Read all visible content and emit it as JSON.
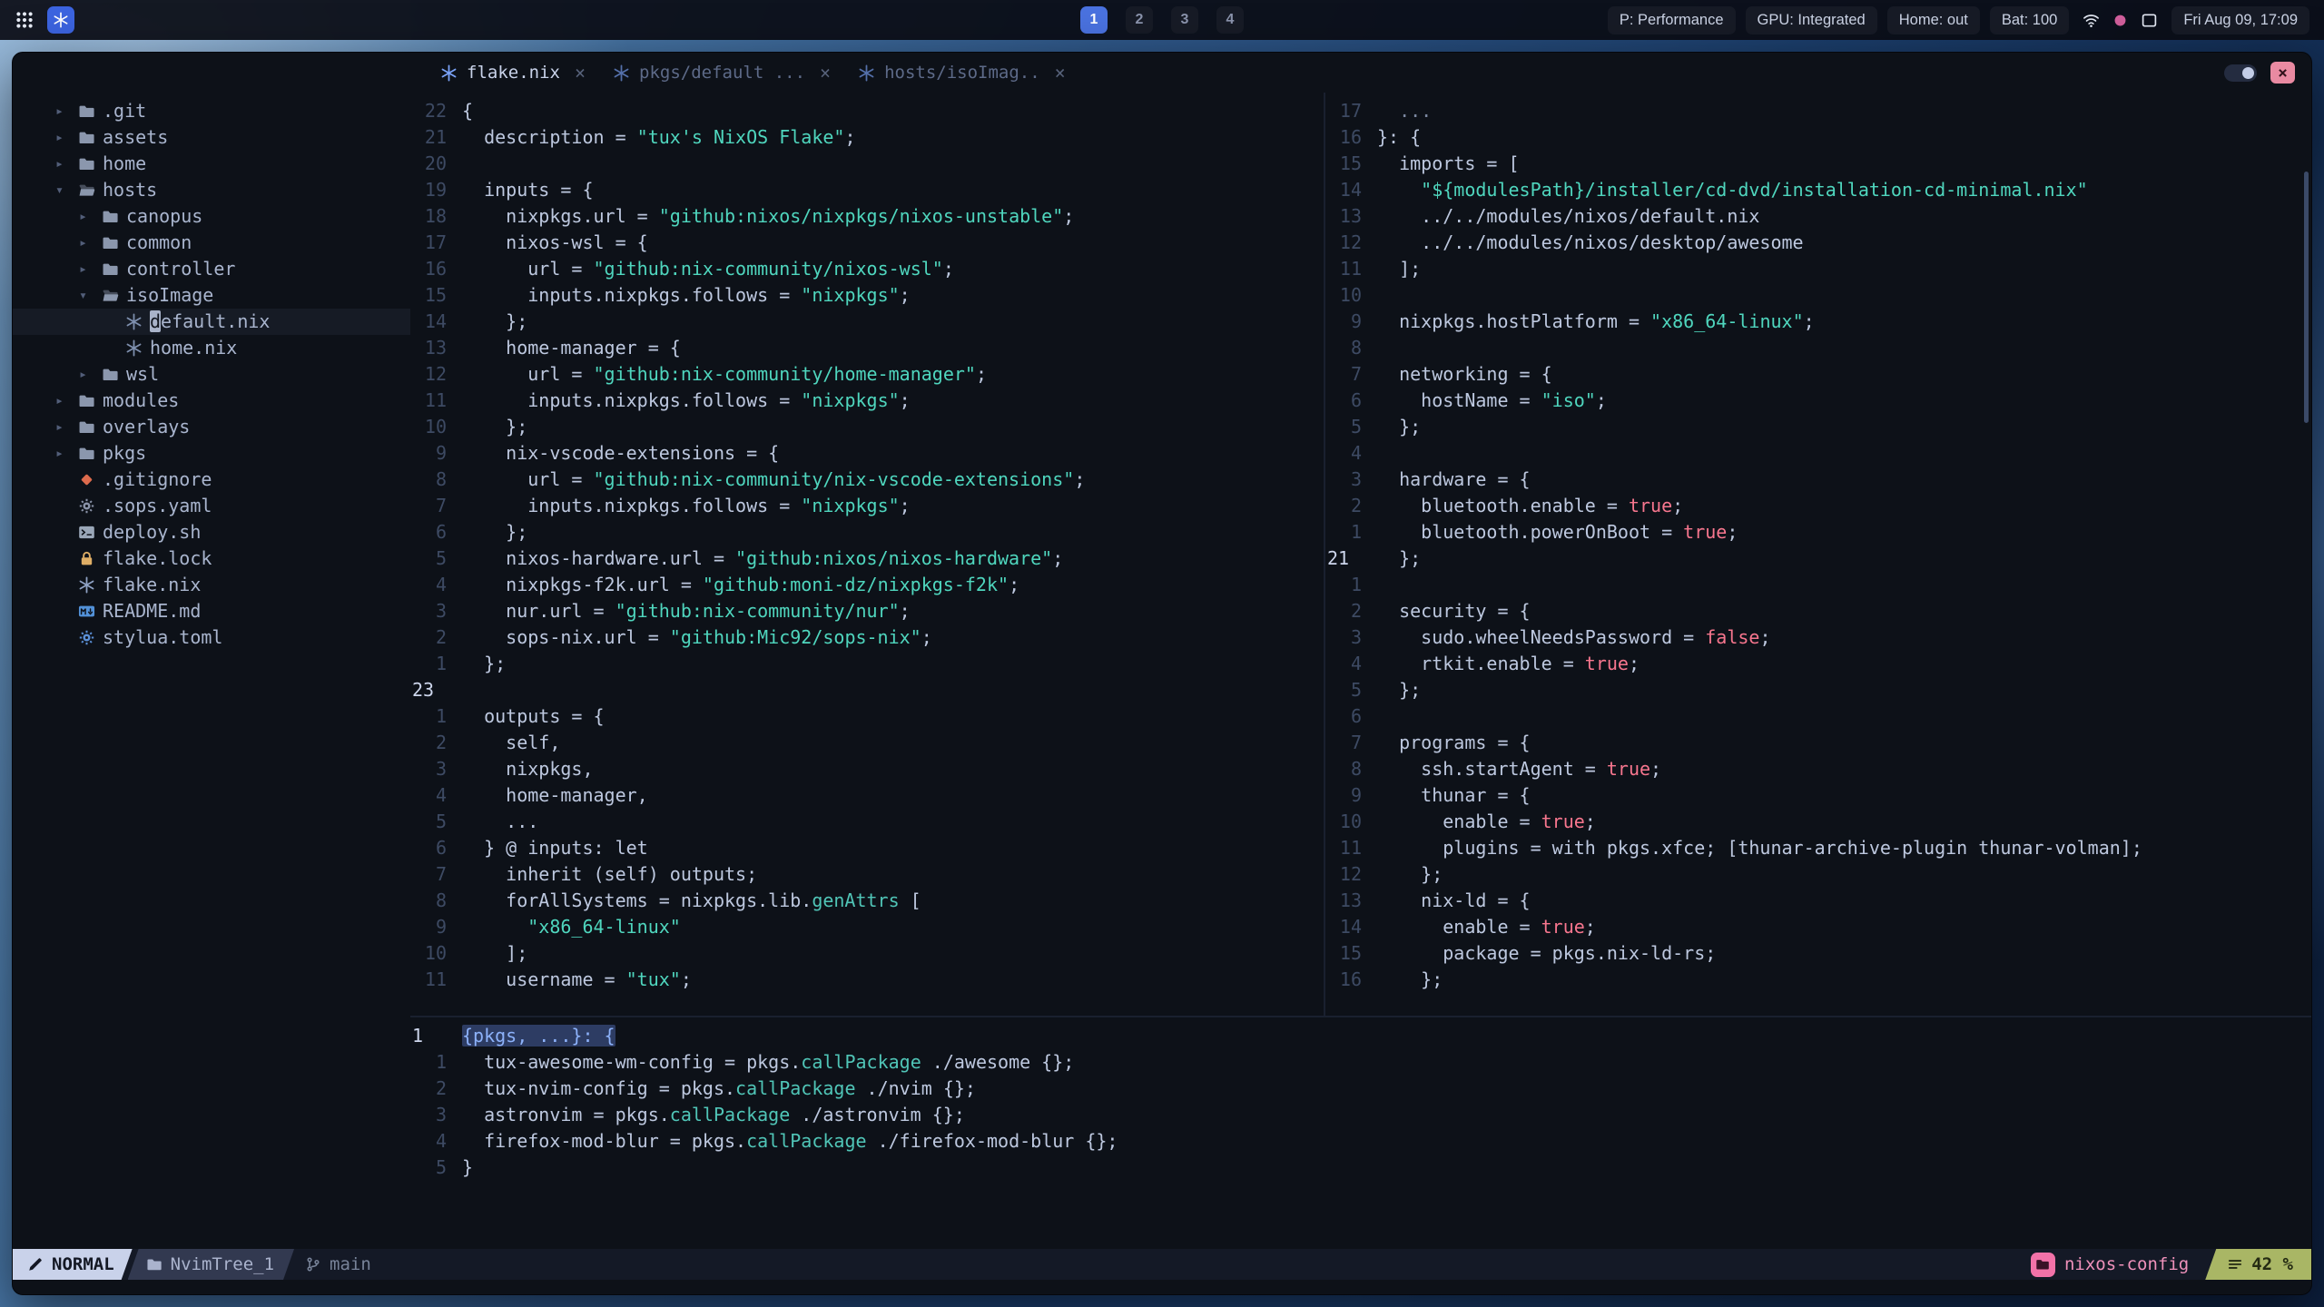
{
  "theme": {
    "editor_bg": "#0d1118",
    "string_teal": "#4fd6be",
    "boolean_pink": "#f7768e",
    "accent_blue": "#7aa2f7",
    "workspace_active_blue": "#4a72e0",
    "mode_segment_bg": "#c9d2ea",
    "percent_green": "#a9b665",
    "project_pink": "#f272a8",
    "close_button_red": "#e98aa2"
  },
  "topbar": {
    "workspaces": [
      {
        "label": "1",
        "active": true
      },
      {
        "label": "2",
        "active": false
      },
      {
        "label": "3",
        "active": false
      },
      {
        "label": "4",
        "active": false
      }
    ],
    "status": [
      {
        "label": "P: Performance"
      },
      {
        "label": "GPU: Integrated"
      },
      {
        "label": "Home: out"
      },
      {
        "label": "Bat: 100"
      }
    ],
    "tray_icons": [
      {
        "name": "wifi-icon",
        "icon": "wifi-icon"
      },
      {
        "name": "indicator-dot-icon",
        "icon": "dot-icon",
        "color": "#d15f9c"
      },
      {
        "name": "screen-icon",
        "icon": "screen-icon"
      }
    ],
    "clock": "Fri Aug 09, 17:09"
  },
  "window": {
    "close_glyph": "×",
    "tabs": [
      {
        "label": "flake.nix",
        "active": true
      },
      {
        "label": "pkgs/default ...",
        "active": false
      },
      {
        "label": "hosts/isoImag..",
        "active": false
      }
    ]
  },
  "filetree": {
    "items": [
      {
        "label": ".git",
        "depth": 0,
        "type": "dir",
        "expanded": false,
        "icon": "folder-icon",
        "color": "#8b97ad"
      },
      {
        "label": "assets",
        "depth": 0,
        "type": "dir",
        "expanded": false,
        "icon": "folder-icon",
        "color": "#8b97ad"
      },
      {
        "label": "home",
        "depth": 0,
        "type": "dir",
        "expanded": false,
        "icon": "folder-icon",
        "color": "#8b97ad"
      },
      {
        "label": "hosts",
        "depth": 0,
        "type": "dir",
        "expanded": true,
        "icon": "folder-open-icon",
        "color": "#8b97ad"
      },
      {
        "label": "canopus",
        "depth": 1,
        "type": "dir",
        "expanded": false,
        "icon": "folder-icon",
        "color": "#8b97ad"
      },
      {
        "label": "common",
        "depth": 1,
        "type": "dir",
        "expanded": false,
        "icon": "folder-icon",
        "color": "#8b97ad"
      },
      {
        "label": "controller",
        "depth": 1,
        "type": "dir",
        "expanded": false,
        "icon": "folder-icon",
        "color": "#8b97ad"
      },
      {
        "label": "isoImage",
        "depth": 1,
        "type": "dir",
        "expanded": true,
        "icon": "folder-open-icon",
        "color": "#8b97ad"
      },
      {
        "label": "default.nix",
        "depth": 2,
        "type": "file",
        "icon": "nix-icon",
        "color": "#7e8fae",
        "cursor": true
      },
      {
        "label": "home.nix",
        "depth": 2,
        "type": "file",
        "icon": "nix-icon",
        "color": "#7e8fae"
      },
      {
        "label": "wsl",
        "depth": 1,
        "type": "dir",
        "expanded": false,
        "icon": "folder-icon",
        "color": "#8b97ad"
      },
      {
        "label": "modules",
        "depth": 0,
        "type": "dir",
        "expanded": false,
        "icon": "folder-icon",
        "color": "#8b97ad"
      },
      {
        "label": "overlays",
        "depth": 0,
        "type": "dir",
        "expanded": false,
        "icon": "folder-icon",
        "color": "#8b97ad"
      },
      {
        "label": "pkgs",
        "depth": 0,
        "type": "dir",
        "expanded": false,
        "icon": "folder-icon",
        "color": "#8b97ad"
      },
      {
        "label": ".gitignore",
        "depth": 0,
        "type": "file",
        "icon": "git-icon",
        "color": "#dd6b4d"
      },
      {
        "label": ".sops.yaml",
        "depth": 0,
        "type": "file",
        "icon": "gear-icon",
        "color": "#8a93a8"
      },
      {
        "label": "deploy.sh",
        "depth": 0,
        "type": "file",
        "icon": "terminal-icon",
        "color": "#9aa7b8"
      },
      {
        "label": "flake.lock",
        "depth": 0,
        "type": "file",
        "icon": "lock-icon",
        "color": "#dfae66"
      },
      {
        "label": "flake.nix",
        "depth": 0,
        "type": "file",
        "icon": "nix-icon",
        "color": "#8fa2c4"
      },
      {
        "label": "README.md",
        "depth": 0,
        "type": "file",
        "icon": "markdown-icon",
        "color": "#5291d8"
      },
      {
        "label": "stylua.toml",
        "depth": 0,
        "type": "file",
        "icon": "gear-icon",
        "color": "#5a8fd6"
      }
    ]
  },
  "editor": {
    "flake": {
      "lines": [
        {
          "n": "22",
          "t": "{"
        },
        {
          "n": "21",
          "t": "  description = \"tux's NixOS Flake\";"
        },
        {
          "n": "20",
          "t": ""
        },
        {
          "n": "19",
          "t": "  inputs = {"
        },
        {
          "n": "18",
          "t": "    nixpkgs.url = \"github:nixos/nixpkgs/nixos-unstable\";"
        },
        {
          "n": "17",
          "t": "    nixos-wsl = {"
        },
        {
          "n": "16",
          "t": "      url = \"github:nix-community/nixos-wsl\";"
        },
        {
          "n": "15",
          "t": "      inputs.nixpkgs.follows = \"nixpkgs\";"
        },
        {
          "n": "14",
          "t": "    };"
        },
        {
          "n": "13",
          "t": "    home-manager = {"
        },
        {
          "n": "12",
          "t": "      url = \"github:nix-community/home-manager\";"
        },
        {
          "n": "11",
          "t": "      inputs.nixpkgs.follows = \"nixpkgs\";"
        },
        {
          "n": "10",
          "t": "    };"
        },
        {
          "n": "9",
          "t": "    nix-vscode-extensions = {"
        },
        {
          "n": "8",
          "t": "      url = \"github:nix-community/nix-vscode-extensions\";"
        },
        {
          "n": "7",
          "t": "      inputs.nixpkgs.follows = \"nixpkgs\";"
        },
        {
          "n": "6",
          "t": "    };"
        },
        {
          "n": "5",
          "t": "    nixos-hardware.url = \"github:nixos/nixos-hardware\";"
        },
        {
          "n": "4",
          "t": "    nixpkgs-f2k.url = \"github:moni-dz/nixpkgs-f2k\";"
        },
        {
          "n": "3",
          "t": "    nur.url = \"github:nix-community/nur\";"
        },
        {
          "n": "2",
          "t": "    sops-nix.url = \"github:Mic92/sops-nix\";"
        },
        {
          "n": "1",
          "t": "  };"
        },
        {
          "n": "23",
          "cur": true,
          "t": ""
        },
        {
          "n": "1",
          "t": "  outputs = {"
        },
        {
          "n": "2",
          "t": "    self,"
        },
        {
          "n": "3",
          "t": "    nixpkgs,"
        },
        {
          "n": "4",
          "t": "    home-manager,"
        },
        {
          "n": "5",
          "t": "    ..."
        },
        {
          "n": "6",
          "t": "  } @ inputs: let"
        },
        {
          "n": "7",
          "t": "    inherit (self) outputs;"
        },
        {
          "n": "8",
          "t": "    forAllSystems = nixpkgs.lib.genAttrs ["
        },
        {
          "n": "9",
          "t": "      \"x86_64-linux\""
        },
        {
          "n": "10",
          "t": "    ];"
        },
        {
          "n": "11",
          "t": "    username = \"tux\";"
        }
      ]
    },
    "iso": {
      "lines": [
        {
          "n": "17",
          "t": "  ...",
          "dim": true
        },
        {
          "n": "16",
          "t": "}: {"
        },
        {
          "n": "15",
          "t": "  imports = ["
        },
        {
          "n": "14",
          "t": "    \"${modulesPath}/installer/cd-dvd/installation-cd-minimal.nix\""
        },
        {
          "n": "13",
          "t": "    ../../modules/nixos/default.nix"
        },
        {
          "n": "12",
          "t": "    ../../modules/nixos/desktop/awesome"
        },
        {
          "n": "11",
          "t": "  ];"
        },
        {
          "n": "10",
          "t": ""
        },
        {
          "n": "9",
          "t": "  nixpkgs.hostPlatform = \"x86_64-linux\";"
        },
        {
          "n": "8",
          "t": ""
        },
        {
          "n": "7",
          "t": "  networking = {"
        },
        {
          "n": "6",
          "t": "    hostName = \"iso\";"
        },
        {
          "n": "5",
          "t": "  };"
        },
        {
          "n": "4",
          "t": ""
        },
        {
          "n": "3",
          "t": "  hardware = {"
        },
        {
          "n": "2",
          "t": "    bluetooth.enable = true;"
        },
        {
          "n": "1",
          "t": "    bluetooth.powerOnBoot = true;"
        },
        {
          "n": "21",
          "cur": true,
          "t": "  };"
        },
        {
          "n": "1",
          "t": ""
        },
        {
          "n": "2",
          "t": "  security = {"
        },
        {
          "n": "3",
          "t": "    sudo.wheelNeedsPassword = false;"
        },
        {
          "n": "4",
          "t": "    rtkit.enable = true;"
        },
        {
          "n": "5",
          "t": "  };"
        },
        {
          "n": "6",
          "t": ""
        },
        {
          "n": "7",
          "t": "  programs = {"
        },
        {
          "n": "8",
          "t": "    ssh.startAgent = true;"
        },
        {
          "n": "9",
          "t": "    thunar = {"
        },
        {
          "n": "10",
          "t": "      enable = true;"
        },
        {
          "n": "11",
          "t": "      plugins = with pkgs.xfce; [thunar-archive-plugin thunar-volman];"
        },
        {
          "n": "12",
          "t": "    };"
        },
        {
          "n": "13",
          "t": "    nix-ld = {"
        },
        {
          "n": "14",
          "t": "      enable = true;"
        },
        {
          "n": "15",
          "t": "      package = pkgs.nix-ld-rs;"
        },
        {
          "n": "16",
          "t": "    };"
        }
      ]
    },
    "pkgs": {
      "lines": [
        {
          "n": "1",
          "cur": true,
          "sel": true,
          "t": "{pkgs, ...}: {"
        },
        {
          "n": "1",
          "t": "  tux-awesome-wm-config = pkgs.callPackage ./awesome {};"
        },
        {
          "n": "2",
          "t": "  tux-nvim-config = pkgs.callPackage ./nvim {};"
        },
        {
          "n": "3",
          "t": "  astronvim = pkgs.callPackage ./astronvim {};"
        },
        {
          "n": "4",
          "t": "  firefox-mod-blur = pkgs.callPackage ./firefox-mod-blur {};"
        },
        {
          "n": "5",
          "t": "}"
        }
      ]
    }
  },
  "statusline": {
    "mode": "NORMAL",
    "buffer": "NvimTree_1",
    "git_branch": "main",
    "project": "nixos-config",
    "position_percent": "42 %"
  }
}
